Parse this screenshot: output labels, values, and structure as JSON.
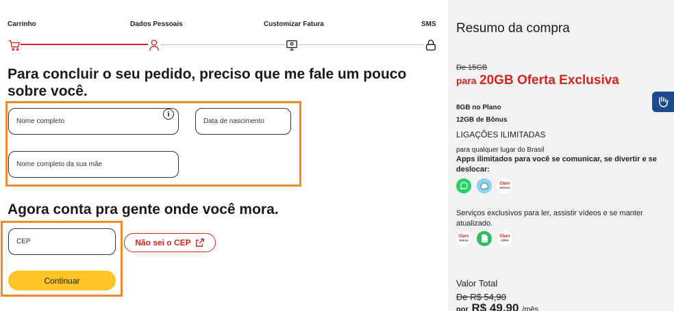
{
  "stepper": {
    "steps": [
      {
        "label": "Carrinho",
        "icon": "cart-icon"
      },
      {
        "label": "Dados Pessoais",
        "icon": "user-icon"
      },
      {
        "label": "Customizar Fatura",
        "icon": "monitor-icon"
      },
      {
        "label": "SMS",
        "icon": "lock-icon"
      }
    ],
    "active_color": "#d6221e"
  },
  "form": {
    "heading": "Para concluir o seu pedido, preciso que me fale um pouco sobre você.",
    "full_name_placeholder": "Nome completo",
    "birth_date_placeholder": "Data de nascimento",
    "mother_name_placeholder": "Nome completo da sua mãe",
    "info_glyph": "i"
  },
  "address": {
    "heading": "Agora conta pra gente onde você mora.",
    "cep_placeholder": "CEP",
    "unknown_cep_label": "Não sei o CEP",
    "continue_label": "Continuar"
  },
  "summary": {
    "title": "Resumo da compra",
    "old_plan": "De 15GB",
    "offer_prefix": "para",
    "offer_main": "20GB Oferta Exclusiva",
    "plan_gb": "8GB no Plano",
    "bonus_gb": "12GB de Bônus",
    "calls_title": "LIGAÇÕES ILIMITADAS",
    "calls_desc": "para qualquer lugar do Brasil",
    "apps_desc": "Apps ilimitados para você se comunicar, se divertir e se deslocar:",
    "apps": [
      {
        "icon": "whatsapp-icon",
        "color": "#25d366"
      },
      {
        "icon": "waze-icon",
        "color": "#8ad3f0"
      },
      {
        "icon": "claro-musica-icon",
        "name": "Claro música",
        "label_top": "Claro",
        "label_bottom": "música"
      }
    ],
    "services_desc": "Serviços exclusivos para ler, assistir vídeos e se manter atualizado.",
    "services": [
      {
        "icon": "claro-banca-icon",
        "label_top": "Claro",
        "label_bottom": "banca"
      },
      {
        "icon": "evernote-icon",
        "color": "#2dbe60"
      },
      {
        "icon": "claro-video-icon",
        "label_top": "Claro",
        "label_bottom": "vídeo"
      }
    ],
    "total_label": "Valor Total",
    "old_price": "De R$ 54,90",
    "new_price_prefix": "por",
    "new_price": "R$ 49,90",
    "new_price_suffix": "/mês"
  },
  "accessibility": {
    "icon": "sign-language-icon",
    "color": "#1d4a8c"
  },
  "highlight_color": "#f08a26",
  "button_yellow": "#fcc424"
}
